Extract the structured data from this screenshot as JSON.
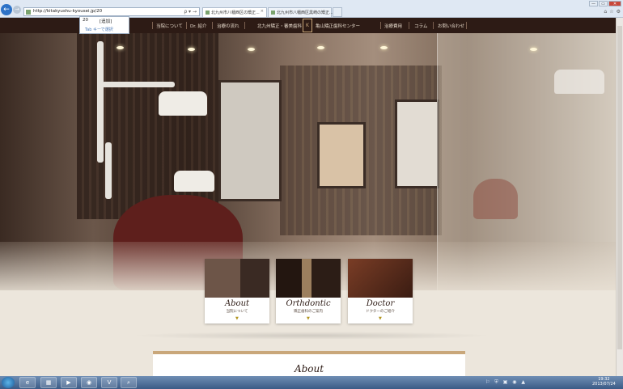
{
  "browser": {
    "url": "http://kitakyushu-kyousei.jp/20",
    "addr_controls": "ρ ▾ →",
    "tabs": [
      {
        "label": "北九州市八幡西区の矯正...",
        "close": "×"
      },
      {
        "label": "北九州市八幡西区黒崎の矯正..."
      }
    ],
    "window_buttons": [
      "—",
      "▭",
      "✕"
    ],
    "tool_icons": [
      "⌂",
      "☆",
      "⚙"
    ],
    "suggest": {
      "items": [
        {
          "key": "20",
          "value": "[追加]"
        }
      ],
      "hint": "Tab キーで選択"
    }
  },
  "site": {
    "nav": [
      "当院について",
      "Dr. 紹介",
      "治療の流れ",
      "治療費用",
      "コラム",
      "お問い合わせ"
    ],
    "brand_left": "北九州矯正・審美歯科",
    "brand_right": "亀山矯正歯科センター",
    "logo_text": "K"
  },
  "cards": [
    {
      "title": "About",
      "sub": "当院について",
      "arrow": "▼"
    },
    {
      "title": "Orthdontic",
      "sub": "矯正歯科のご案内",
      "arrow": "▼"
    },
    {
      "title": "Doctor",
      "sub": "ドクターのご紹介",
      "arrow": "▼"
    }
  ],
  "about_panel": {
    "title": "About"
  },
  "taskbar": {
    "apps": [
      "e",
      "▦",
      "▶",
      "◉",
      "V",
      "⌕"
    ],
    "tray": "⚐ ⛨ ▣ ◉ ▲",
    "time": "19:32",
    "date": "2013/07/24"
  }
}
